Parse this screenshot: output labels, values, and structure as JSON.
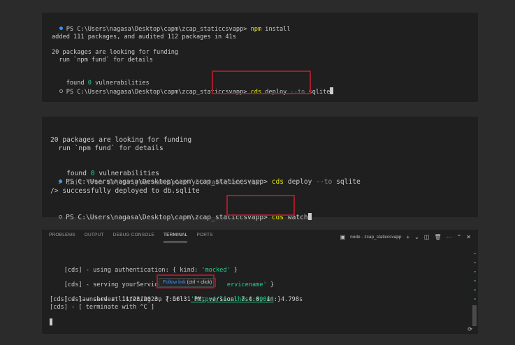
{
  "panel1": {
    "lines": [
      {
        "prompt": "PS C:\\Users\\nagasa\\Desktop\\capm\\zcap_staticcsvapp>",
        "cmd": "npm",
        "rest": " install"
      },
      {
        "text": "added 111 packages, and audited 112 packages in 41s"
      },
      {
        "text": "20 packages are looking for funding"
      },
      {
        "text": "  run `npm fund` for details"
      },
      {
        "text_pre": "found ",
        "num": "0",
        "text_post": " vulnerabilities"
      },
      {
        "prompt": "PS C:\\Users\\nagasa\\Desktop\\capm\\zcap_staticcsvapp>",
        "cmd": "cds",
        "mid": " deploy ",
        "gray": "--to",
        "rest": " sqlite"
      }
    ]
  },
  "panel2": {
    "l1": "20 packages are looking for funding",
    "l2": "  run `npm fund` for details",
    "found_pre": "found ",
    "found_num": "0",
    "found_post": " vulnerabilities",
    "prompt1": "PS C:\\Users\\nagasa\\Desktop\\capm\\zcap_staticcsvapp>",
    "cmd1": "cds",
    "cmd1_mid": " deploy ",
    "cmd1_gray": "--to",
    "cmd1_rest": " sqlite",
    "init_line": "  > init from db\\csv\\yournamespace-yourtablename.csv",
    "success_line": "/> successfully deployed to db.sqlite",
    "prompt2": "PS C:\\Users\\nagasa\\Desktop\\capm\\zcap_staticcsvapp>",
    "cmd2": "cds",
    "cmd2_rest": " watch"
  },
  "panel3": {
    "tabs": [
      "PROBLEMS",
      "OUTPUT",
      "DEBUG CONSOLE",
      "TERMINAL",
      "PORTS"
    ],
    "active_tab": "TERMINAL",
    "terminal_name": "node - zcap_staticcsvapp",
    "l1_pre": "[cds] - using authentication: { kind: ",
    "l1_val": "'mocked'",
    "l1_post": " }",
    "l2_pre": "[cds] - serving yourServicename { p",
    "l2_val": "ervicename'",
    "l2_post": " }",
    "l3_pre": "[cds] - server listening on { url: ",
    "l3_url": "'http://localhost:4004'",
    "l3_post": " }",
    "l4": "[cds] - launched at 11/23/2023, 7:56:31 PM, version: 7.4.0, in: 4.798s",
    "l5": "[cds] - [ terminate with ^C ]",
    "tooltip_link": "Follow link",
    "tooltip_rest": " (ctrl + click)"
  }
}
